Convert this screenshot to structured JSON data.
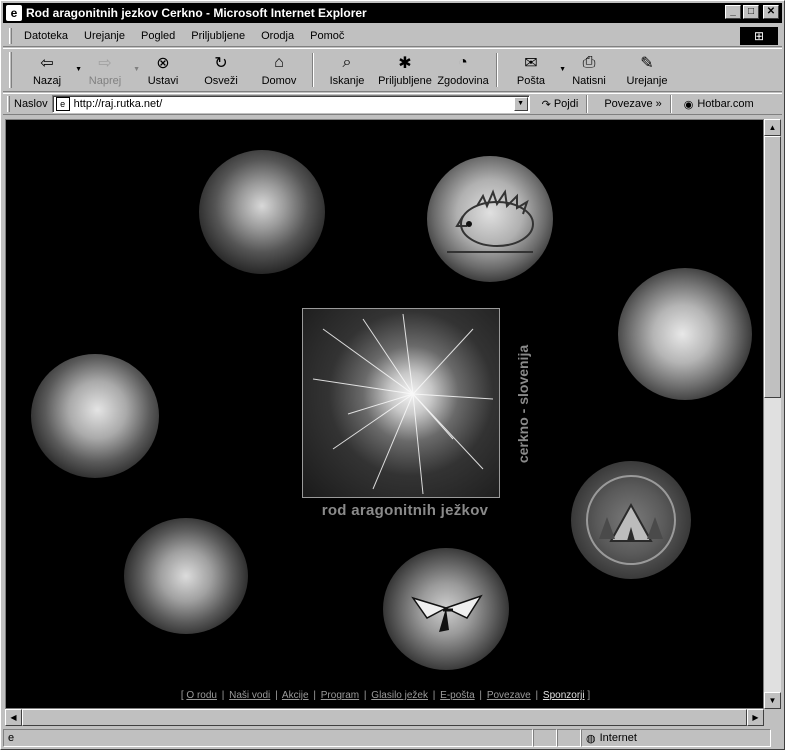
{
  "window": {
    "title": "Rod aragonitnih jezkov Cerkno - Microsoft Internet Explorer",
    "minimize": "_",
    "maximize": "□",
    "close": "✕"
  },
  "menu": {
    "items": [
      "Datoteka",
      "Urejanje",
      "Pogled",
      "Priljubljene",
      "Orodja",
      "Pomoč"
    ]
  },
  "toolbar": {
    "buttons": [
      {
        "label": "Nazaj",
        "icon": "back-arrow-icon",
        "enabled": true
      },
      {
        "label": "Naprej",
        "icon": "forward-arrow-icon",
        "enabled": false
      },
      {
        "label": "Ustavi",
        "icon": "stop-icon",
        "enabled": true
      },
      {
        "label": "Osveži",
        "icon": "refresh-icon",
        "enabled": true
      },
      {
        "label": "Domov",
        "icon": "home-icon",
        "enabled": true
      },
      {
        "label": "Iskanje",
        "icon": "search-icon",
        "enabled": true
      },
      {
        "label": "Priljubljene",
        "icon": "favorites-icon",
        "enabled": true
      },
      {
        "label": "Zgodovina",
        "icon": "history-icon",
        "enabled": true
      },
      {
        "label": "Pošta",
        "icon": "mail-icon",
        "enabled": true
      },
      {
        "label": "Natisni",
        "icon": "print-icon",
        "enabled": true
      },
      {
        "label": "Urejanje",
        "icon": "edit-icon",
        "enabled": true
      }
    ]
  },
  "addressbar": {
    "label": "Naslov",
    "url": "http://raj.rutka.net/",
    "go": "Pojdi",
    "links": "Povezave",
    "hotbar": "Hotbar.com"
  },
  "page": {
    "site_title": "rod aragonitnih ježkov",
    "site_subtitle": "cerkno - slovenija",
    "nav_open": "[",
    "nav_close": "]",
    "nav_sep": "|",
    "nav": [
      "O rodu",
      "Naši vodi",
      "Akcije",
      "Program",
      "Glasilo ježek",
      "E-pošta",
      "Povezave",
      "Sponzorji"
    ]
  },
  "statusbar": {
    "zone": "Internet"
  }
}
